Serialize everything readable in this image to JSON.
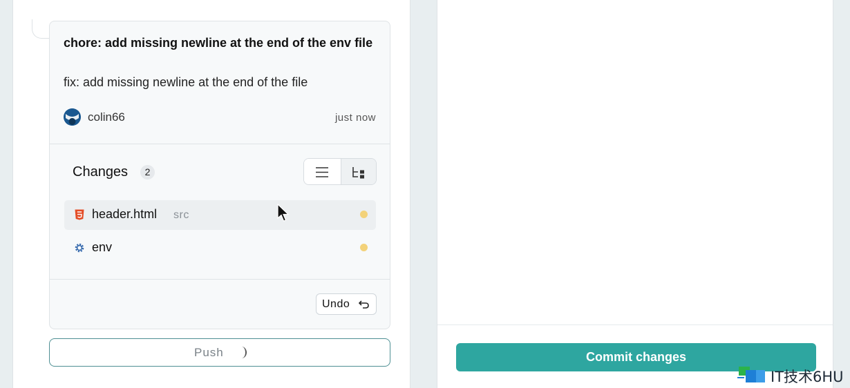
{
  "commit": {
    "title": "chore: add missing newline at the end of the env file",
    "body": "fix: add missing newline at the end of the file",
    "author": "colin66",
    "timestamp": "just now"
  },
  "changes": {
    "heading": "Changes",
    "count": "2",
    "view_options": [
      "list-icon",
      "tree-icon"
    ],
    "files": [
      {
        "name": "header.html",
        "dir": "src",
        "icon": "html5-icon",
        "status": "modified",
        "selected": true
      },
      {
        "name": "env",
        "dir": "",
        "icon": "gear-icon",
        "status": "modified",
        "selected": false
      }
    ],
    "undo_label": "Undo"
  },
  "push": {
    "label": "Push",
    "state": "loading"
  },
  "commit_panel": {
    "button_label": "Commit changes"
  },
  "watermark": {
    "text": "IT技术6HU"
  },
  "colors": {
    "accent": "#2ea6a0",
    "push_border": "#4e8f93",
    "modified_dot": "#f3d27a",
    "html_icon": "#e34c26"
  }
}
